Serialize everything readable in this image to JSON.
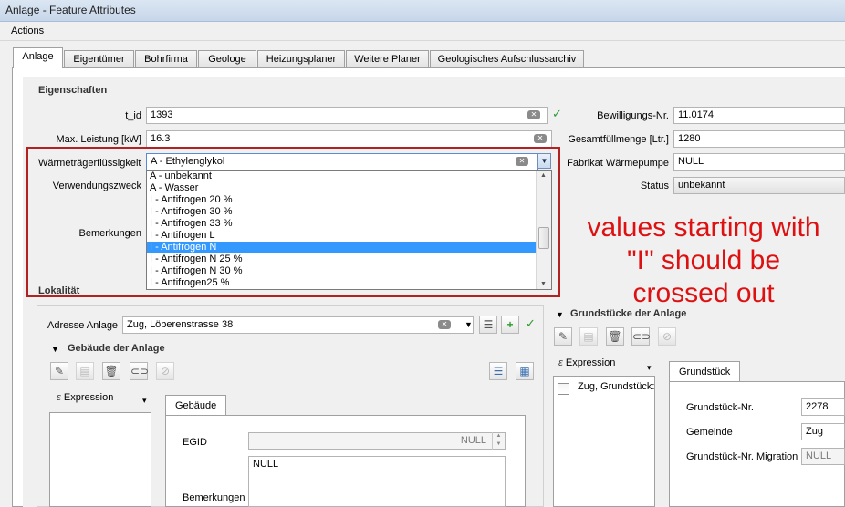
{
  "window": {
    "title": "Anlage - Feature Attributes"
  },
  "menu": {
    "actions": "Actions"
  },
  "tabs": [
    "Anlage",
    "Eigentümer",
    "Bohrfirma",
    "Geologe",
    "Heizungsplaner",
    "Weitere Planer",
    "Geologisches Aufschlussarchiv"
  ],
  "eigenschaften": {
    "title": "Eigenschaften",
    "t_id_label": "t_id",
    "t_id_value": "1393",
    "max_leistung_label": "Max. Leistung [kW]",
    "max_leistung_value": "16.3",
    "waermetraeger_label": "Wärmeträgerflüssigkeit",
    "waermetraeger_value": "A - Ethylenglykol",
    "verwendungszweck_label": "Verwendungszweck",
    "bemerkungen_label": "Bemerkungen",
    "bewilligung_label": "Bewilligungs-Nr.",
    "bewilligung_value": "11.0174",
    "gesamtfuellmenge_label": "Gesamtfüllmenge [Ltr.]",
    "gesamtfuellmenge_value": "1280",
    "fabrikat_label": "Fabrikat Wärmepumpe",
    "fabrikat_value": "NULL",
    "status_label": "Status",
    "status_value": "unbekannt"
  },
  "dropdown_options": [
    "A - unbekannt",
    "A - Wasser",
    "I - Antifrogen 20 %",
    "I - Antifrogen 30 %",
    "I - Antifrogen 33 %",
    "I - Antifrogen L",
    "I - Antifrogen N",
    "I - Antifrogen N 25 %",
    "I - Antifrogen N 30 %",
    "I - Antifrogen25 %"
  ],
  "dropdown_selected_index": 6,
  "annotation": {
    "line1": "values starting with",
    "line2": "\"I\" should be",
    "line3": "crossed out"
  },
  "lokalitaet": {
    "title": "Lokalität",
    "adresse_label": "Adresse Anlage",
    "adresse_value": "Zug, Löberenstrasse 38",
    "gebaeude_title": "Gebäude der Anlage",
    "expression_label": "Expression",
    "gebaeude_tab": "Gebäude",
    "egid_label": "EGID",
    "egid_value": "NULL",
    "bemerkungen_label": "Bemerkungen",
    "bemerkungen_value": "NULL"
  },
  "grundstuecke": {
    "title": "Grundstücke der Anlage",
    "expression_label": "Expression",
    "list_item": "Zug, Grundstück:",
    "tab": "Grundstück",
    "nr_label": "Grundstück-Nr.",
    "nr_value": "2278",
    "gemeinde_label": "Gemeinde",
    "gemeinde_value": "Zug",
    "migration_label": "Grundstück-Nr. Migration",
    "migration_value": "NULL"
  }
}
